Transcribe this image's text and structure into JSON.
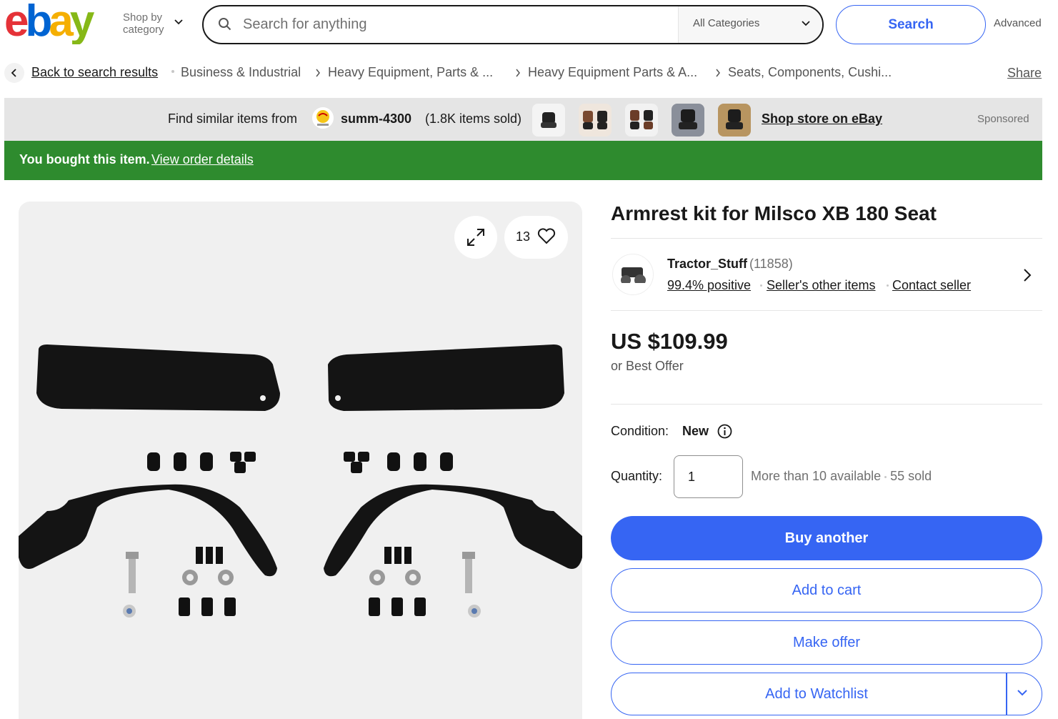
{
  "header": {
    "logo_alt": "ebay",
    "shop_by_line1": "Shop by",
    "shop_by_line2": "category",
    "search_placeholder": "Search for anything",
    "category_select": "All Categories",
    "search_button": "Search",
    "advanced": "Advanced",
    "brand_colors": [
      "#e53238",
      "#0064d2",
      "#f5af02",
      "#86b817"
    ]
  },
  "breadcrumb": {
    "back": "Back to search results",
    "items": [
      "Business & Industrial",
      "Heavy Equipment, Parts & ...",
      "Heavy Equipment Parts & A...",
      "Seats, Components, Cushi..."
    ],
    "share": "Share"
  },
  "store_banner": {
    "find_similar": "Find similar items from",
    "store_name": "summ-4300",
    "items_sold": "(1.8K items sold)",
    "shop_store": "Shop store on eBay",
    "sponsored": "Sponsored"
  },
  "bought_banner": {
    "text": "You bought this item.",
    "link": "View order details",
    "color": "#2e8b2e"
  },
  "gallery": {
    "watch_count": "13"
  },
  "listing": {
    "title": "Armrest kit for Milsco XB 180 Seat",
    "seller_name": "Tractor_Stuff",
    "seller_feedback": "(11858)",
    "seller_positive": "99.4% positive",
    "seller_other": "Seller's other items",
    "contact_seller": "Contact seller",
    "price": "US $109.99",
    "best_offer": "or Best Offer",
    "condition_label": "Condition:",
    "condition_value": "New",
    "quantity_label": "Quantity:",
    "quantity_value": "1",
    "available": "More than 10 available",
    "sold": "55 sold"
  },
  "actions": {
    "buy_another": "Buy another",
    "add_to_cart": "Add to cart",
    "make_offer": "Make offer",
    "add_to_watchlist": "Add to Watchlist",
    "accent": "#3665f3"
  }
}
